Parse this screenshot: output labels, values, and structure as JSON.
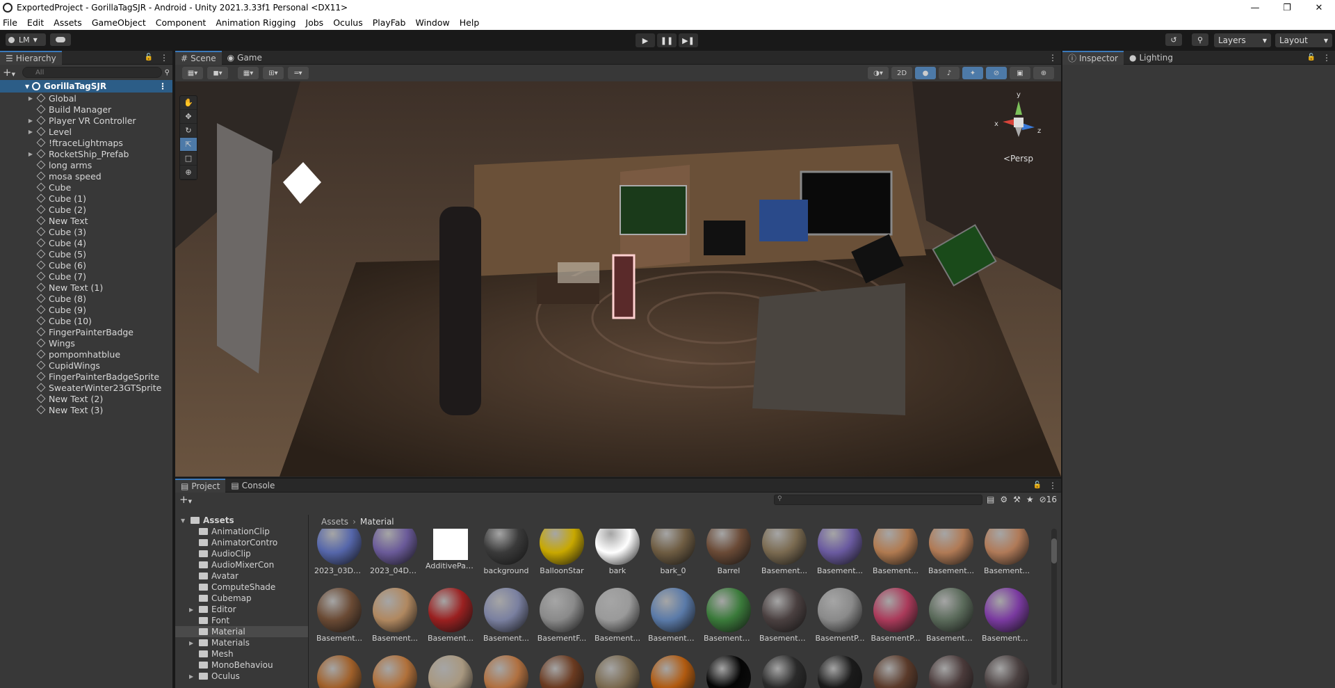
{
  "window": {
    "title": "ExportedProject - GorillaTagSJR - Android - Unity 2021.3.33f1 Personal <DX11>"
  },
  "menu": [
    "File",
    "Edit",
    "Assets",
    "GameObject",
    "Component",
    "Animation Rigging",
    "Jobs",
    "Oculus",
    "PlayFab",
    "Window",
    "Help"
  ],
  "toolbar": {
    "account": "LM",
    "layers": "Layers",
    "layout": "Layout"
  },
  "hierarchy": {
    "tab": "Hierarchy",
    "search_placeholder": "All",
    "scene": "GorillaTagSJR",
    "items": [
      {
        "label": "Global",
        "expandable": true
      },
      {
        "label": "Build Manager",
        "expandable": false
      },
      {
        "label": "Player VR Controller",
        "expandable": true
      },
      {
        "label": "Level",
        "expandable": true
      },
      {
        "label": "!ftraceLightmaps",
        "expandable": false
      },
      {
        "label": "RocketShip_Prefab",
        "expandable": true
      },
      {
        "label": "long arms",
        "expandable": false
      },
      {
        "label": "mosa speed",
        "expandable": false
      },
      {
        "label": "Cube",
        "expandable": false
      },
      {
        "label": "Cube (1)",
        "expandable": false
      },
      {
        "label": "Cube (2)",
        "expandable": false
      },
      {
        "label": "New Text",
        "expandable": false
      },
      {
        "label": "Cube (3)",
        "expandable": false
      },
      {
        "label": "Cube (4)",
        "expandable": false
      },
      {
        "label": "Cube (5)",
        "expandable": false
      },
      {
        "label": "Cube (6)",
        "expandable": false
      },
      {
        "label": "Cube (7)",
        "expandable": false
      },
      {
        "label": "New Text (1)",
        "expandable": false
      },
      {
        "label": "Cube (8)",
        "expandable": false
      },
      {
        "label": "Cube (9)",
        "expandable": false
      },
      {
        "label": "Cube (10)",
        "expandable": false
      },
      {
        "label": "FingerPainterBadge",
        "expandable": false
      },
      {
        "label": "Wings",
        "expandable": false
      },
      {
        "label": "pompomhatblue",
        "expandable": false
      },
      {
        "label": "CupidWings",
        "expandable": false
      },
      {
        "label": "FingerPainterBadgeSprite",
        "expandable": false
      },
      {
        "label": "SweaterWinter23GTSprite",
        "expandable": false
      },
      {
        "label": "New Text (2)",
        "expandable": false
      },
      {
        "label": "New Text (3)",
        "expandable": false
      }
    ]
  },
  "scene": {
    "tabs": [
      "Scene",
      "Game"
    ],
    "mode_2d": "2D",
    "persp": "Persp",
    "axis_labels": {
      "x": "x",
      "y": "y",
      "z": "z"
    }
  },
  "inspector": {
    "tabs": [
      "Inspector",
      "Lighting"
    ]
  },
  "project": {
    "tabs": [
      "Project",
      "Console"
    ],
    "hidden_count": "16",
    "breadcrumb": [
      "Assets",
      "Material"
    ],
    "tree": [
      {
        "label": "Assets",
        "level": 0,
        "expandable": true
      },
      {
        "label": "AnimationClip",
        "level": 1,
        "expandable": false
      },
      {
        "label": "AnimatorContro",
        "level": 1,
        "expandable": false
      },
      {
        "label": "AudioClip",
        "level": 1,
        "expandable": false
      },
      {
        "label": "AudioMixerCon",
        "level": 1,
        "expandable": false
      },
      {
        "label": "Avatar",
        "level": 1,
        "expandable": false
      },
      {
        "label": "ComputeShade",
        "level": 1,
        "expandable": false
      },
      {
        "label": "Cubemap",
        "level": 1,
        "expandable": false
      },
      {
        "label": "Editor",
        "level": 1,
        "expandable": true
      },
      {
        "label": "Font",
        "level": 1,
        "expandable": false
      },
      {
        "label": "Material",
        "level": 1,
        "expandable": false,
        "selected": true
      },
      {
        "label": "Materials",
        "level": 1,
        "expandable": true
      },
      {
        "label": "Mesh",
        "level": 1,
        "expandable": false
      },
      {
        "label": "MonoBehaviou",
        "level": 1,
        "expandable": false
      },
      {
        "label": "Oculus",
        "level": 1,
        "expandable": true
      }
    ],
    "assets": [
      {
        "name": "2023_03Du...",
        "color": "#5566aa"
      },
      {
        "name": "2023_04Du...",
        "color": "#6a5a99"
      },
      {
        "name": "AdditivePart...",
        "color": "#ffffff",
        "square": true
      },
      {
        "name": "background",
        "color": "#3a3a3a"
      },
      {
        "name": "BalloonStar",
        "color": "#c8a800"
      },
      {
        "name": "bark",
        "color": "#ffffff"
      },
      {
        "name": "bark_0",
        "color": "#6e5c42"
      },
      {
        "name": "Barrel",
        "color": "#6a4a36"
      },
      {
        "name": "Basement...",
        "color": "#7a6a50"
      },
      {
        "name": "Basement...",
        "color": "#6a5aa0"
      },
      {
        "name": "Basement...",
        "color": "#b07a50"
      },
      {
        "name": "Basement...",
        "color": "#b07a55"
      },
      {
        "name": "Basement...",
        "color": "#b07a58"
      },
      {
        "name": "Basement...",
        "color": "#6a4a34"
      },
      {
        "name": "Basement...",
        "color": "#b08860"
      },
      {
        "name": "Basement...",
        "color": "#9a2020"
      },
      {
        "name": "Basement...",
        "color": "#7a80a0"
      },
      {
        "name": "BasementF...",
        "color": "#8a8a8a"
      },
      {
        "name": "Basement...",
        "color": "#9a9a9a"
      },
      {
        "name": "BasementL...",
        "color": "#5a7aa8"
      },
      {
        "name": "BasementL...",
        "color": "#3a7a3a"
      },
      {
        "name": "BasementL...",
        "color": "#4a4040"
      },
      {
        "name": "BasementP...",
        "color": "#8a8a8a"
      },
      {
        "name": "BasementP...",
        "color": "#aa3a5a"
      },
      {
        "name": "BasementR...",
        "color": "#5a6a5a"
      },
      {
        "name": "BasementR...",
        "color": "#7a3aa0"
      },
      {
        "name": "",
        "color": "#a0602a"
      },
      {
        "name": "",
        "color": "#b0703a"
      },
      {
        "name": "",
        "color": "#a89880"
      },
      {
        "name": "",
        "color": "#b07040"
      },
      {
        "name": "",
        "color": "#6a3a20"
      },
      {
        "name": "",
        "color": "#7a6a50"
      },
      {
        "name": "",
        "color": "#b05a10"
      },
      {
        "name": "",
        "color": "#050505"
      },
      {
        "name": "",
        "color": "#2a2a2a"
      },
      {
        "name": "",
        "color": "#1a1a1a"
      },
      {
        "name": "",
        "color": "#5a3a2a"
      },
      {
        "name": "",
        "color": "#4a3a3a"
      },
      {
        "name": "",
        "color": "#4a4040"
      }
    ]
  },
  "colors": {
    "accent": "#3a79bb",
    "selection": "#2c5d87",
    "panel": "#383838",
    "bg": "#191919"
  }
}
